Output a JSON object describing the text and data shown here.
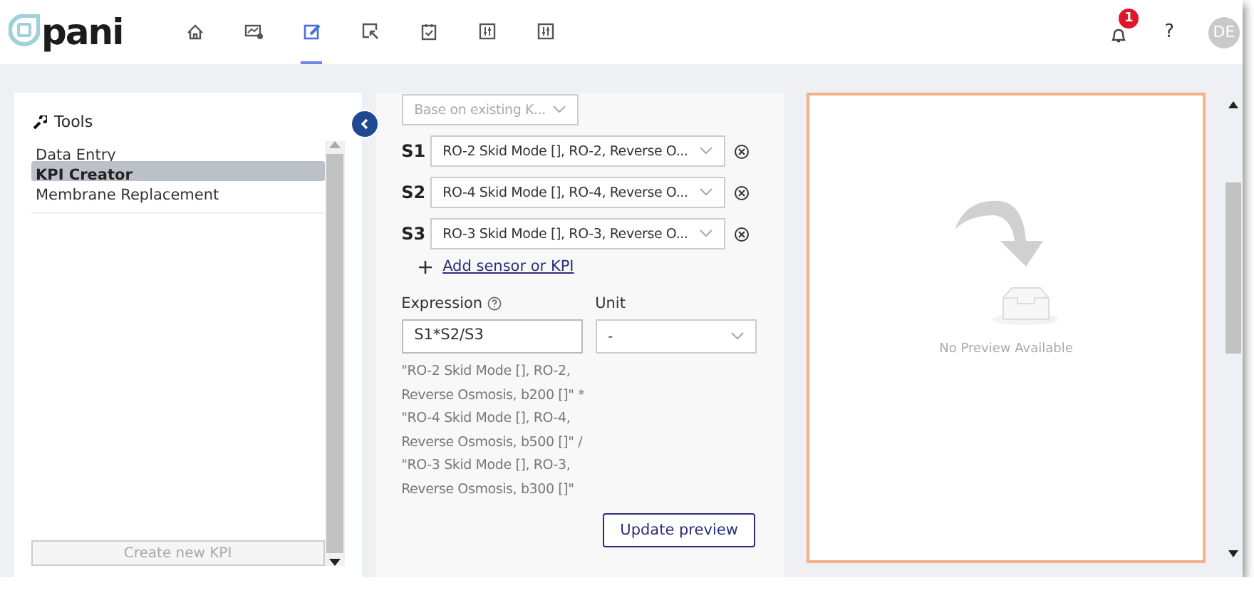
{
  "header": {
    "logo": "pani",
    "nav": [
      {
        "kind": "home",
        "selected": false
      },
      {
        "kind": "monitor",
        "selected": false
      },
      {
        "kind": "edit",
        "selected": true
      },
      {
        "kind": "cursor",
        "selected": false
      },
      {
        "kind": "clipboard",
        "selected": false
      },
      {
        "kind": "sliders",
        "selected": false
      },
      {
        "kind": "sliders",
        "selected": false
      }
    ],
    "notification_count": "1",
    "help": "?",
    "avatar": "DE"
  },
  "tools": {
    "title": "Tools",
    "items": [
      {
        "label": "Data Entry",
        "selected": false
      },
      {
        "label": "KPI Creator",
        "selected": true
      },
      {
        "label": "Membrane Replacement",
        "selected": false
      }
    ],
    "create_button": {
      "label": "Create new KPI",
      "disabled": true
    }
  },
  "form": {
    "base_select": {
      "placeholder": "Base on existing K..."
    },
    "sensors": [
      {
        "label": "S1",
        "value": "RO-2 Skid Mode [], RO-2, Reverse O..."
      },
      {
        "label": "S2",
        "value": "RO-4 Skid Mode [], RO-4, Reverse O..."
      },
      {
        "label": "S3",
        "value": "RO-3 Skid Mode [], RO-3, Reverse O..."
      }
    ],
    "add_link": "Add sensor or KPI",
    "expression": {
      "label": "Expression",
      "value": "S1*S2/S3"
    },
    "unit": {
      "label": "Unit",
      "value": "-"
    },
    "description": "\"RO-2 Skid Mode [], RO-2, Reverse Osmosis, b200 []\" * \"RO-4 Skid Mode [], RO-4, Reverse Osmosis, b500 []\" / \"RO-3 Skid Mode [], RO-3, Reverse Osmosis, b300 []\"",
    "update_button": "Update preview"
  },
  "preview": {
    "message": "No Preview Available"
  }
}
